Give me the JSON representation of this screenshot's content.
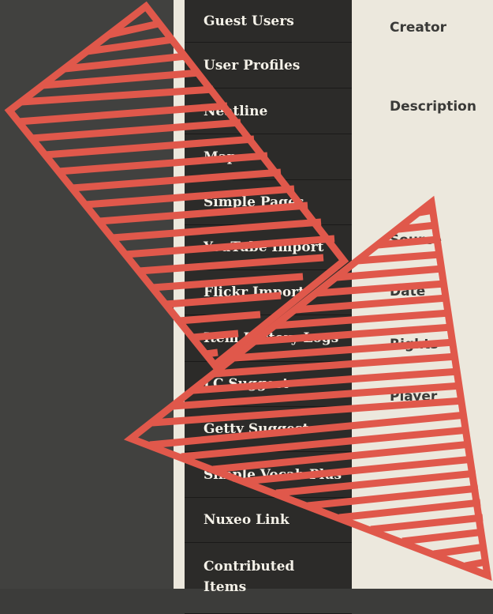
{
  "colors": {
    "left_background": "#41413f",
    "nav_background": "#2c2b29",
    "nav_text": "#f4f1e8",
    "content_background": "#ece8dd",
    "label_text": "#3a3a38",
    "overlay_stroke": "#e0584b"
  },
  "nav": {
    "items": [
      {
        "label": "Guest Users"
      },
      {
        "label": "User Profiles"
      },
      {
        "label": "Neatline"
      },
      {
        "label": "Map"
      },
      {
        "label": "Simple Pages"
      },
      {
        "label": "YouTube Import"
      },
      {
        "label": "Flickr Import"
      },
      {
        "label": "Item History Logs"
      },
      {
        "label": "LC Suggest"
      },
      {
        "label": "Getty Suggest"
      },
      {
        "label": "Simple Vocab Plus"
      },
      {
        "label": "Nuxeo Link"
      },
      {
        "label": "Contributed Items"
      }
    ]
  },
  "main": {
    "fields": [
      {
        "label": "Creator"
      },
      {
        "label": "Description"
      },
      {
        "label": "Source"
      },
      {
        "label": "Date"
      },
      {
        "label": "Rights"
      },
      {
        "label": "Player"
      }
    ]
  }
}
